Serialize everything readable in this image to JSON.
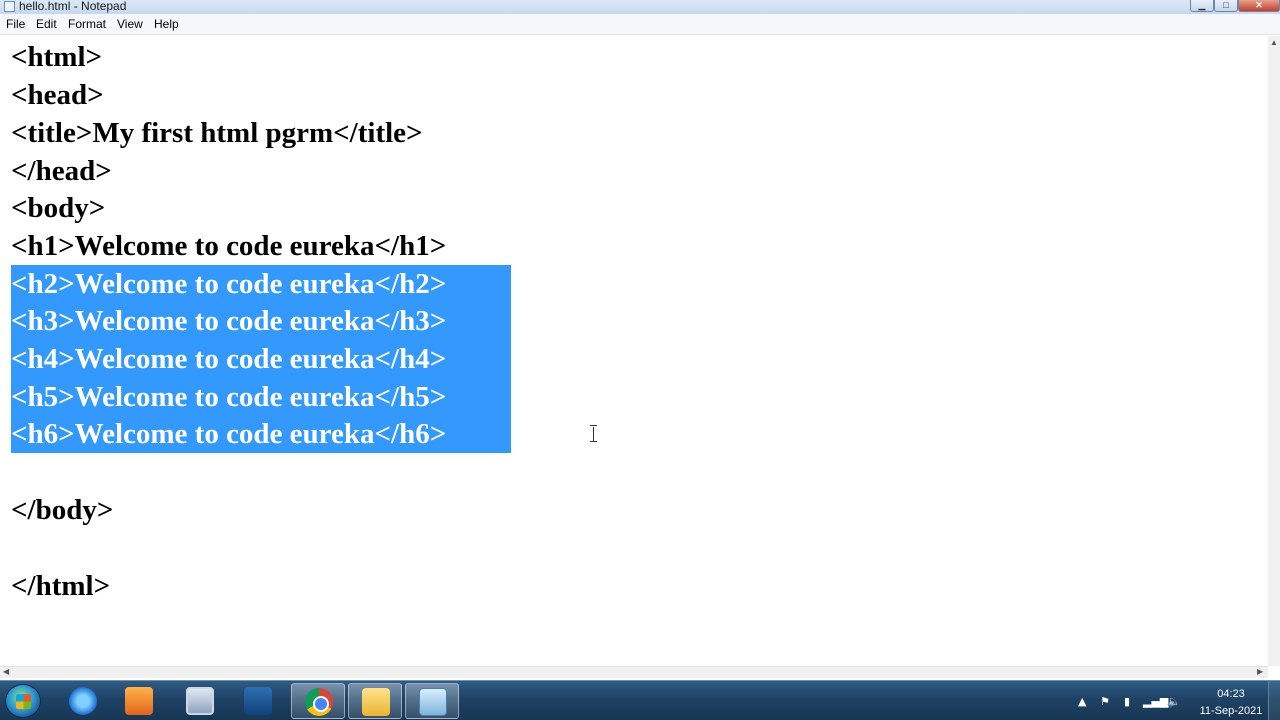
{
  "window": {
    "title": "hello.html - Notepad",
    "controls": {
      "minimize": "▁",
      "maximize": "□",
      "close": "✕"
    }
  },
  "menu": [
    "File",
    "Edit",
    "Format",
    "View",
    "Help"
  ],
  "editor": {
    "lines": [
      "<html>",
      "<head>",
      "<title>My first html pgrm</title>",
      "</head>",
      "<body>",
      "<h1>Welcome to code eureka</h1>",
      "<h2>Welcome to code eureka</h2>",
      "<h3>Welcome to code eureka</h3>",
      "<h4>Welcome to code eureka</h4>",
      "<h5>Welcome to code eureka</h5>",
      "<h6>Welcome to code eureka</h6>",
      "",
      "</body>",
      "",
      "</html>"
    ],
    "selected_lines": [
      6,
      7,
      8,
      9,
      10
    ],
    "selection_color": "#3399ff"
  },
  "taskbar": {
    "apps": [
      "internet-explorer-icon",
      "media-player-icon",
      "screen-recorder-icon",
      "checkmark-app-icon",
      "chrome-icon",
      "file-explorer-icon",
      "notepad-icon"
    ],
    "active_app": "notepad-icon",
    "tray": {
      "arrow": "▲",
      "flag": "⚑",
      "network": "▮",
      "signal": "▂▄▆",
      "volume": "🔈"
    },
    "clock": {
      "time": "04:23",
      "date": "11-Sep-2021"
    }
  }
}
